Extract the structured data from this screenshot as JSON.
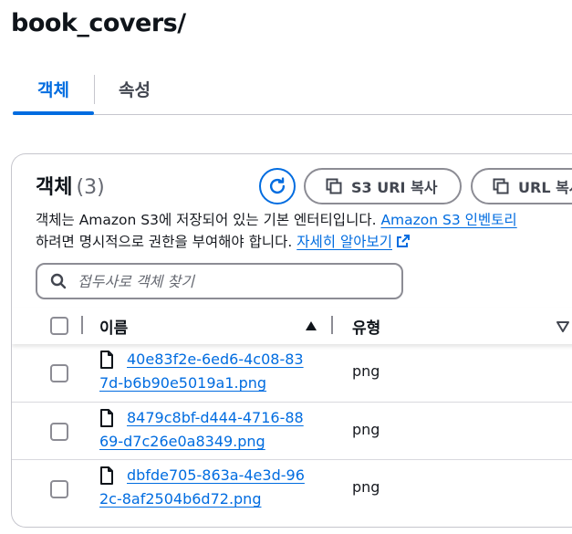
{
  "page": {
    "title": "book_covers/"
  },
  "tabs": [
    {
      "label": "객체",
      "active": true
    },
    {
      "label": "속성",
      "active": false
    }
  ],
  "objects": {
    "heading": "객체",
    "count": "(3)",
    "refresh_icon": "refresh-icon",
    "copy_s3_uri_label": "S3 URI 복사",
    "copy_url_label": "URL 복사",
    "desc_line1_text": "객체는 Amazon S3에 저장되어 있는 기본 엔터티입니다. ",
    "desc_line1_link": "Amazon S3 인벤토리",
    "desc_line2_text": "하려면 명시적으로 권한을 부여해야 합니다. ",
    "desc_line2_link": "자세히 알아보기",
    "search_placeholder": "접두사로 객체 찾기",
    "columns": {
      "name": "이름",
      "type": "유형"
    },
    "sort": "name-ascending",
    "rows": [
      {
        "name": "40e83f2e-6ed6-4c08-837d-b6b90e5019a1.png",
        "type": "png"
      },
      {
        "name": "8479c8bf-d444-4716-8869-d7c26e0a8349.png",
        "type": "png"
      },
      {
        "name": "dbfde705-863a-4e3d-962c-8af2504b6d72.png",
        "type": "png"
      }
    ]
  },
  "colors": {
    "accent": "#006ce0",
    "border": "#8c8c94",
    "text": "#16191f"
  }
}
